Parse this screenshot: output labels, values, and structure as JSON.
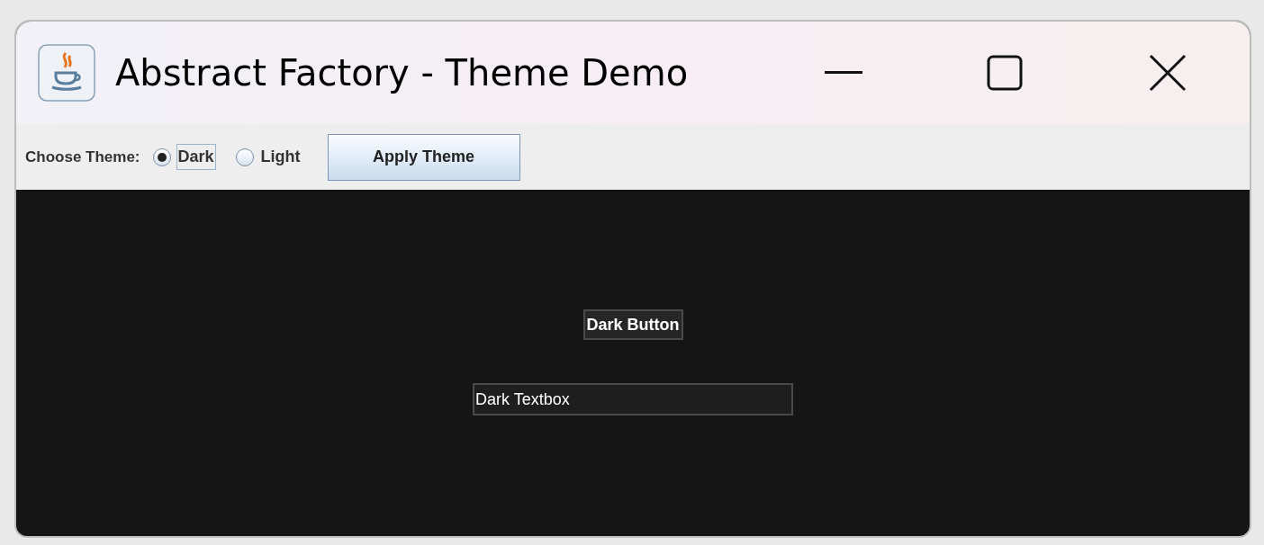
{
  "window": {
    "title": "Abstract Factory - Theme Demo"
  },
  "toolbar": {
    "label": "Choose Theme:",
    "options": [
      {
        "label": "Dark",
        "selected": true,
        "focused": true
      },
      {
        "label": "Light",
        "selected": false,
        "focused": false
      }
    ],
    "apply_button": "Apply Theme"
  },
  "content": {
    "button": "Dark Button",
    "textbox_value": "Dark Textbox"
  }
}
